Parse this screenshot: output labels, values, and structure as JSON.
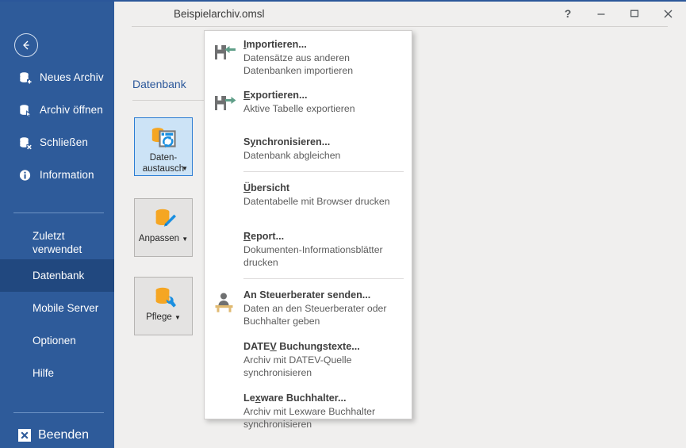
{
  "window": {
    "title": "Beispielarchiv.omsl",
    "controls": [
      {
        "name": "help-button",
        "glyph": "?"
      },
      {
        "name": "minimize-button",
        "glyph": "—"
      },
      {
        "name": "maximize-button",
        "glyph": "▭"
      },
      {
        "name": "close-button",
        "glyph": "✕"
      }
    ]
  },
  "sidebar": {
    "back_icon": "back-arrow-icon",
    "accent": "#2e5b9a",
    "selected_bg": "#21487f",
    "items": [
      {
        "label": "Neues Archiv",
        "icon": "database-add-icon"
      },
      {
        "label": "Archiv öffnen",
        "icon": "database-open-icon"
      },
      {
        "label": "Schließen",
        "icon": "database-close-icon"
      },
      {
        "label": "Information",
        "icon": "info-icon"
      }
    ],
    "items2": [
      {
        "label": "Zuletzt verwendet",
        "selected": false
      },
      {
        "label": "Datenbank",
        "selected": true
      },
      {
        "label": "Mobile Server",
        "selected": false
      },
      {
        "label": "Optionen",
        "selected": false
      },
      {
        "label": "Hilfe",
        "selected": false
      }
    ],
    "exit": {
      "label": "Beenden",
      "icon": "exit-x-icon"
    }
  },
  "ribbon": {
    "group_title": "Datenbank",
    "group_title_color": "#2b579a",
    "buttons": [
      {
        "label_line1": "Daten-",
        "label_line2": "austausch",
        "icon": "database-exchange-icon",
        "active": true,
        "has_caret": true
      },
      {
        "label_line1": "Anpassen",
        "label_line2": "",
        "icon": "database-pencil-icon",
        "active": false,
        "has_caret": true
      },
      {
        "label_line1": "Pflege",
        "label_line2": "",
        "icon": "database-wrench-icon",
        "active": false,
        "has_caret": true
      }
    ]
  },
  "menu": {
    "items": [
      {
        "id": "importieren",
        "title_pre": "",
        "title_key": "I",
        "title_post": "mportieren...",
        "desc": "Datensätze aus anderen Datenbanken importieren",
        "icon": "import-floppy-icon",
        "sep_after": false,
        "space_after": false
      },
      {
        "id": "exportieren",
        "title_pre": "",
        "title_key": "E",
        "title_post": "xportieren...",
        "desc": "Aktive Tabelle exportieren",
        "icon": "export-floppy-icon",
        "sep_after": false,
        "space_after": true
      },
      {
        "id": "synchronisieren",
        "title_pre": "S",
        "title_key": "y",
        "title_post": "nchronisieren...",
        "desc": "Datenbank abgleichen",
        "icon": "",
        "sep_after": true,
        "space_after": false
      },
      {
        "id": "uebersicht",
        "title_pre": "",
        "title_key": "Ü",
        "title_post": "bersicht",
        "desc": "Datentabelle mit Browser drucken",
        "icon": "",
        "sep_after": false,
        "space_after": true
      },
      {
        "id": "report",
        "title_pre": "",
        "title_key": "R",
        "title_post": "eport...",
        "desc": "Dokumenten-Informationsblätter drucken",
        "icon": "",
        "sep_after": true,
        "space_after": false
      },
      {
        "id": "an-steuerberater-senden",
        "title_pre": "An Steuerberater senden...",
        "title_key": "",
        "title_post": "",
        "desc": "Daten an den Steuerberater oder Buchhalter geben",
        "icon": "person-desk-icon",
        "sep_after": false,
        "space_after": false
      },
      {
        "id": "datev-buchungstexte",
        "title_pre": "DATE",
        "title_key": "V",
        "title_post": " Buchungstexte...",
        "desc": "Archiv mit DATEV-Quelle synchronisieren",
        "icon": "",
        "sep_after": false,
        "space_after": false
      },
      {
        "id": "lexware-buchhalter",
        "title_pre": "Le",
        "title_key": "x",
        "title_post": "ware Buchhalter...",
        "desc": "Archiv mit Lexware Buchhalter synchronisieren",
        "icon": "",
        "sep_after": false,
        "space_after": false
      }
    ]
  }
}
